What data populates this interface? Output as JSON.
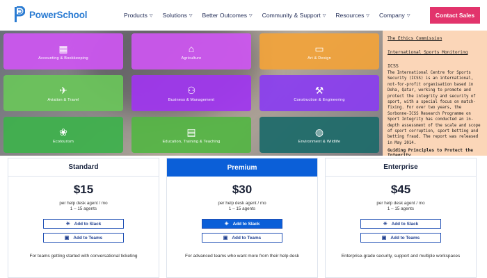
{
  "header": {
    "logo_text": "PowerSchool",
    "nav": [
      {
        "label": "Products"
      },
      {
        "label": "Solutions"
      },
      {
        "label": "Better Outcomes"
      },
      {
        "label": "Community & Support"
      },
      {
        "label": "Resources"
      },
      {
        "label": "Company"
      }
    ],
    "contact_label": "Contact Sales",
    "brand_color": "#2a7bd2",
    "cta_color": "#e2346c"
  },
  "categories": [
    {
      "label": "Accounting & Bookkeeping",
      "icon": "calculator-icon",
      "color": "#d056f2"
    },
    {
      "label": "Agriculture",
      "icon": "barn-icon",
      "color": "#d056f2"
    },
    {
      "label": "Art & Design",
      "icon": "monitor-icon",
      "color": "#f2a33a"
    },
    {
      "label": "Aviation & Travel",
      "icon": "airplane-icon",
      "color": "#6ac55a"
    },
    {
      "label": "Business & Management",
      "icon": "org-chart-icon",
      "color": "#a035f0"
    },
    {
      "label": "Construction & Engineering",
      "icon": "crane-icon",
      "color": "#8a3df0"
    },
    {
      "label": "Ecotourism",
      "icon": "eco-icon",
      "color": "#3fb04d"
    },
    {
      "label": "Education, Training & Teaching",
      "icon": "presentation-icon",
      "color": "#55b545"
    },
    {
      "label": "Environment & Wildlife",
      "icon": "globe-icon",
      "color": "#1f6b6a"
    }
  ],
  "article": {
    "link1": "The Ethics Commission",
    "link2": "International Sports Monitoring",
    "heading": "ICSS",
    "body": "The International Centre for Sports Security (ICSS) is an international, not-for-profit organisation based in Doha, Qatar, working to promote and protect the integrity and security of sport, with a special focus on match-fixing. For over two years, the Sorbonne-ICSS Research Programme on Sport Integrity has conducted an in-depth assessment of the scale and scope of sport corruption, sport betting and betting fraud. The report was released in May 2014.",
    "guide": "Guiding Principles to Protect the Integrity"
  },
  "plans": [
    {
      "name": "Standard",
      "price": "$15",
      "per": "per help desk agent / mo",
      "agents": "1 – 15 agents",
      "slack": "Add to Slack",
      "teams": "Add to Teams",
      "desc": "For teams getting started with conversational ticketing"
    },
    {
      "name": "Premium",
      "price": "$30",
      "per": "per help desk agent / mo",
      "agents": "1 – 15 agents",
      "slack": "Add to Slack",
      "teams": "Add to Teams",
      "desc": "For advanced teams who want more from their help desk"
    },
    {
      "name": "Enterprise",
      "price": "$45",
      "per": "per help desk agent / mo",
      "agents": "1 – 15 agents",
      "slack": "Add to Slack",
      "teams": "Add to Teams",
      "desc": "Enterprise-grade security, support and multiple workspaces"
    }
  ]
}
